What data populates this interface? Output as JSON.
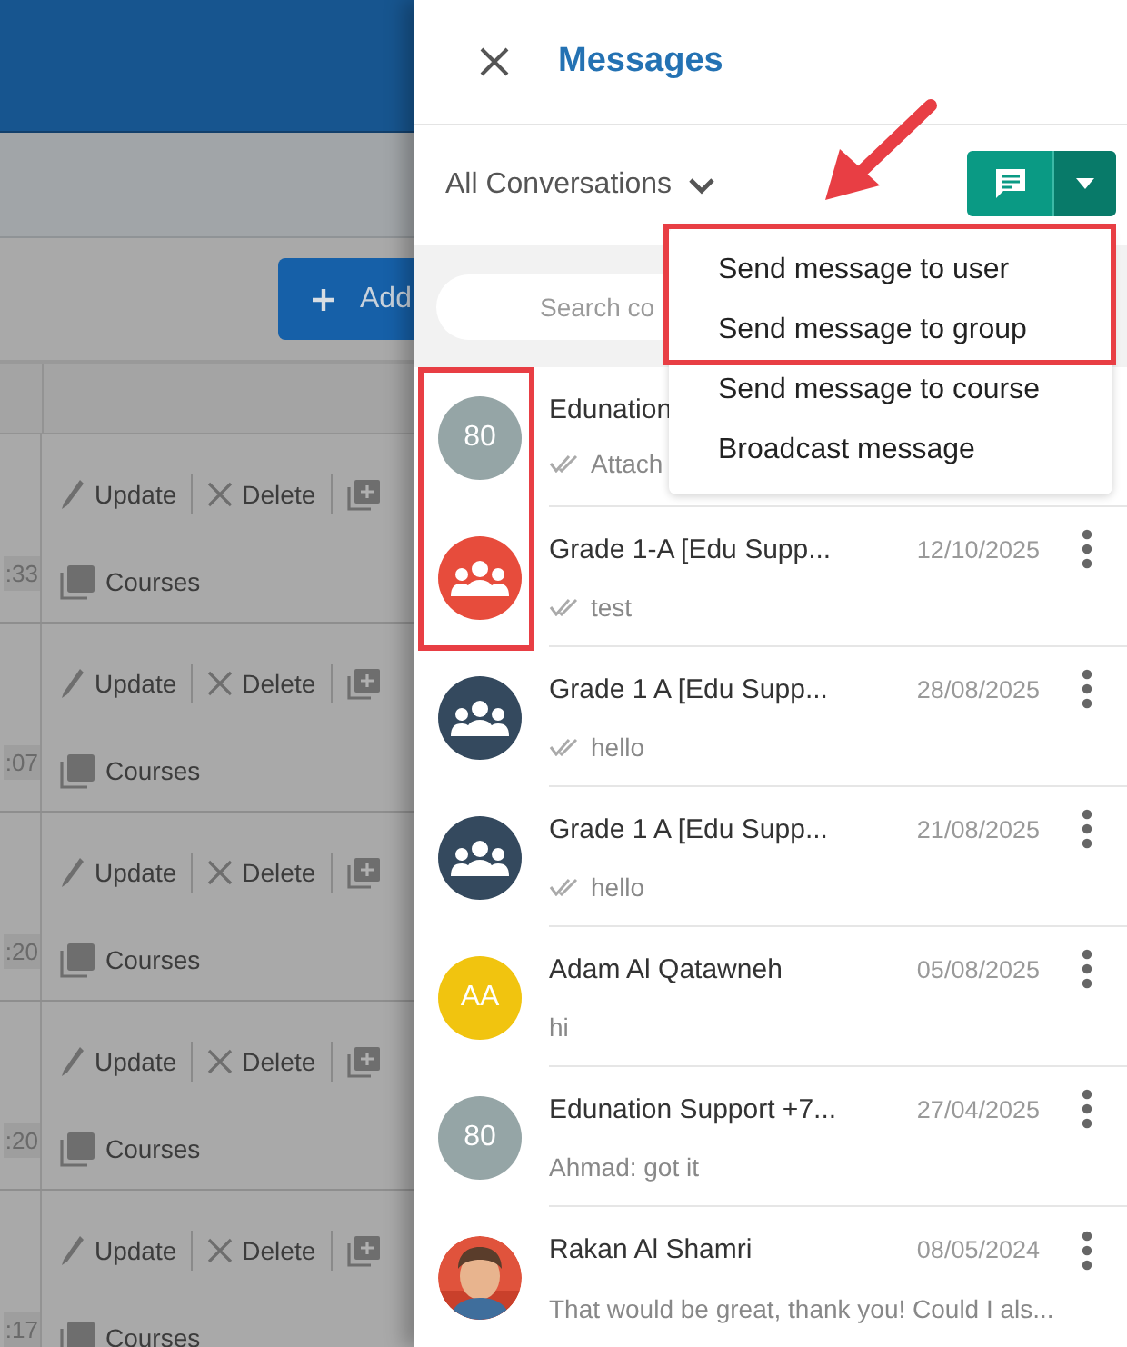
{
  "background": {
    "add_button": "Add",
    "rows": [
      {
        "time": ":33",
        "update": "Update",
        "delete": "Delete",
        "courses": "Courses"
      },
      {
        "time": ":07",
        "update": "Update",
        "delete": "Delete",
        "courses": "Courses"
      },
      {
        "time": ":20",
        "update": "Update",
        "delete": "Delete",
        "courses": "Courses"
      },
      {
        "time": ":20",
        "update": "Update",
        "delete": "Delete",
        "courses": "Courses"
      },
      {
        "time": ":17",
        "update": "Update",
        "delete": "Delete",
        "courses": "Courses"
      }
    ]
  },
  "panel": {
    "title": "Messages",
    "filter": "All Conversations",
    "search": {
      "placeholder": "Search co"
    },
    "new_message_menu": {
      "expanded": true,
      "items": [
        "Send message to user",
        "Send message to group",
        "Send message to course",
        "Broadcast message"
      ]
    },
    "conversations": [
      {
        "name": "Edunation",
        "preview": "Attach",
        "read_check": true,
        "has_menu": false,
        "avatar": {
          "kind": "initials",
          "text": "80",
          "color": "#95a5a6"
        }
      },
      {
        "name": "Grade 1-A [Edu Supp...",
        "date": "12/10/2025",
        "preview": "test",
        "read_check": true,
        "has_menu": true,
        "avatar": {
          "kind": "group",
          "color": "#e74c3c"
        }
      },
      {
        "name": "Grade 1 A [Edu Supp...",
        "date": "28/08/2025",
        "preview": "hello",
        "read_check": true,
        "has_menu": true,
        "avatar": {
          "kind": "group",
          "color": "#34495e"
        }
      },
      {
        "name": "Grade 1 A [Edu Supp...",
        "date": "21/08/2025",
        "preview": "hello",
        "read_check": true,
        "has_menu": true,
        "avatar": {
          "kind": "group",
          "color": "#34495e"
        }
      },
      {
        "name": "Adam Al Qatawneh",
        "date": "05/08/2025",
        "preview": "hi",
        "read_check": false,
        "has_menu": true,
        "avatar": {
          "kind": "initials",
          "text": "AA",
          "color": "#f1c40f"
        }
      },
      {
        "name": "Edunation Support +7...",
        "date": "27/04/2025",
        "preview": "Ahmad: got it",
        "read_check": false,
        "has_menu": true,
        "avatar": {
          "kind": "initials",
          "text": "80",
          "color": "#95a5a6"
        }
      },
      {
        "name": "Rakan Al Shamri",
        "date": "08/05/2024",
        "preview": "That would be great, thank you! Could I als...",
        "read_check": false,
        "has_menu": true
      }
    ]
  },
  "annotations": [
    {
      "kind": "arrow"
    },
    {
      "kind": "menu_box"
    },
    {
      "kind": "avatar_box"
    }
  ]
}
